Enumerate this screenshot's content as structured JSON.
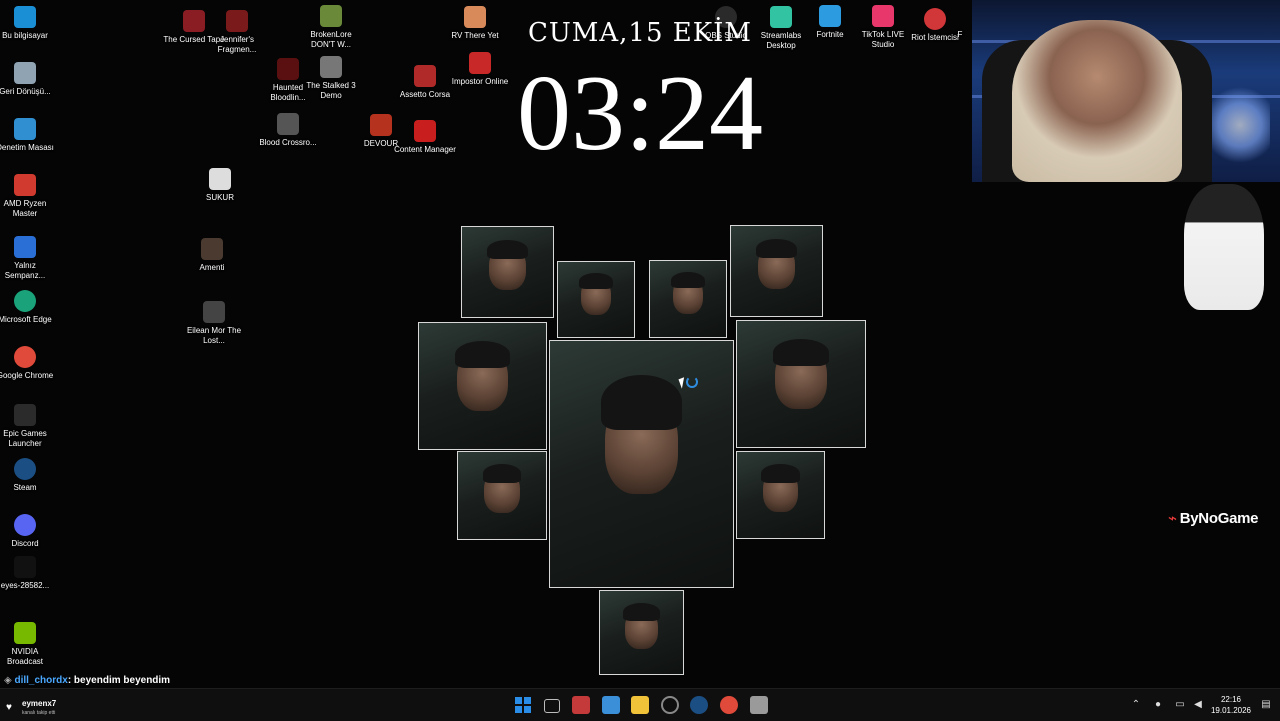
{
  "clock_widget": {
    "date": "CUMA,15 EKİM",
    "time": "03:24"
  },
  "desktop_icons": [
    {
      "label": "Bu bilgisayar",
      "color": "#1b8fd6"
    },
    {
      "label": "Geri Dönüşü...",
      "color": "#8fa3b3"
    },
    {
      "label": "Denetim Masası",
      "color": "#2f8fd0"
    },
    {
      "label": "AMD Ryzen Master",
      "color": "#d13b2f"
    },
    {
      "label": "Yalnız Sempanz...",
      "color": "#2a6fd6"
    },
    {
      "label": "Microsoft Edge",
      "color": "#1aa37a"
    },
    {
      "label": "Google Chrome",
      "color": "#e04a3a"
    },
    {
      "label": "Epic Games Launcher",
      "color": "#2b2b2b"
    },
    {
      "label": "Steam",
      "color": "#1b4f84"
    },
    {
      "label": "Discord",
      "color": "#5865f2"
    },
    {
      "label": "eyes-28582...",
      "color": "#111111"
    },
    {
      "label": "NVIDIA Broadcast",
      "color": "#76b900"
    },
    {
      "label": "The Cursed Tape",
      "color": "#8a1d24"
    },
    {
      "label": "Jennifer's Fragmen...",
      "color": "#7a1a1a"
    },
    {
      "label": "BrokenLore DON'T W...",
      "color": "#6a8a3a"
    },
    {
      "label": "RV There Yet",
      "color": "#d88a5a"
    },
    {
      "label": "Haunted Bloodlin...",
      "color": "#5a1010"
    },
    {
      "label": "The Stalked 3 Demo",
      "color": "#777777"
    },
    {
      "label": "Assetto Corsa",
      "color": "#b02a2a"
    },
    {
      "label": "Impostor Online",
      "color": "#c82828"
    },
    {
      "label": "Blood Crossro...",
      "color": "#555555"
    },
    {
      "label": "DEVOUR",
      "color": "#b4321e"
    },
    {
      "label": "Content Manager",
      "color": "#c81e1e"
    },
    {
      "label": "SUKUR",
      "color": "#dddddd"
    },
    {
      "label": "Amenti",
      "color": "#4a3a30"
    },
    {
      "label": "Eilean Mor The Lost...",
      "color": "#444444"
    },
    {
      "label": "OBS Studio",
      "color": "#2a2a2a"
    },
    {
      "label": "Streamlabs Desktop",
      "color": "#31c3a2"
    },
    {
      "label": "Fortnite",
      "color": "#2d9be0"
    },
    {
      "label": "TikTok LIVE Studio",
      "color": "#e8386b"
    },
    {
      "label": "Riot İstemcisi",
      "color": "#d13639"
    },
    {
      "label": "F",
      "color": "#1a1a1a"
    }
  ],
  "chat": {
    "user": "dill_chordx",
    "message": ": beyendim beyendim"
  },
  "follow_alert": {
    "name": "eymenx7",
    "subtitle": "kanalı takip etti"
  },
  "brand": {
    "name": "ByNoGame",
    "accent": "#e83a3a"
  },
  "taskbar": {
    "apps": [
      {
        "name": "start",
        "color": "#2a8de8"
      },
      {
        "name": "task-view",
        "color": "#bdbdbd"
      },
      {
        "name": "snipping",
        "color": "#c43a3a"
      },
      {
        "name": "store",
        "color": "#3a8fd8"
      },
      {
        "name": "file-explorer",
        "color": "#f0c23a"
      },
      {
        "name": "obs",
        "color": "#888888"
      },
      {
        "name": "steam",
        "color": "#1b4f84"
      },
      {
        "name": "chrome",
        "color": "#e04a3a"
      },
      {
        "name": "streamlabs",
        "color": "#9a9a9a"
      }
    ],
    "tray": {
      "time": "22:16",
      "date": "19.01.2026"
    }
  }
}
